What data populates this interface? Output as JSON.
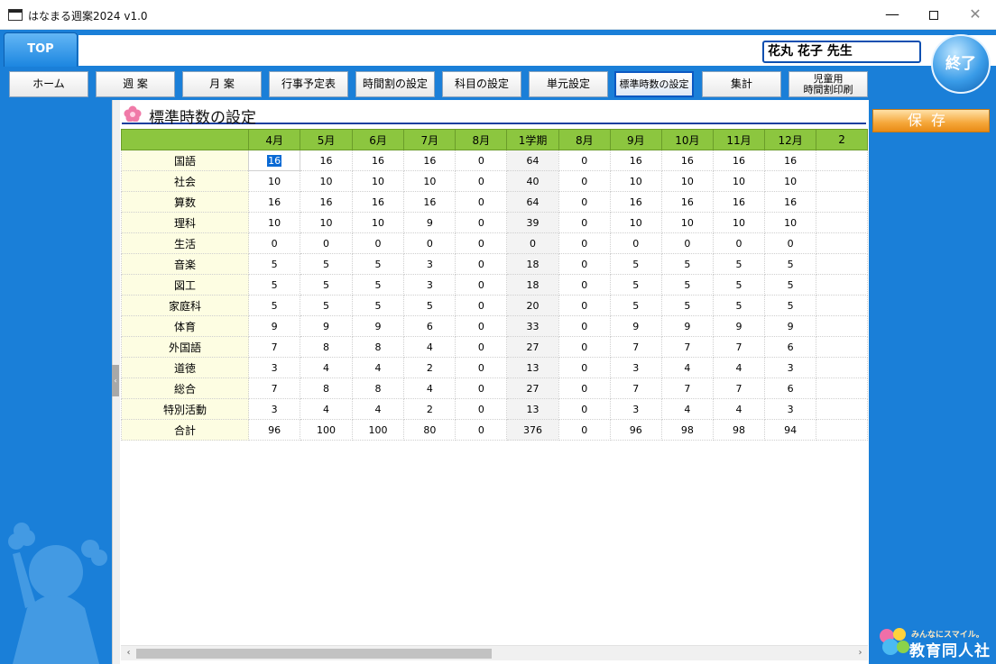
{
  "window": {
    "title": "はなまる週案2024 v1.0",
    "icon_text": "週案",
    "minimize": "—",
    "close": "✕"
  },
  "header": {
    "top_tab": "TOP",
    "user": "花丸 花子 先生",
    "exit": "終了"
  },
  "nav": [
    {
      "label": "ホーム"
    },
    {
      "label": "週 案"
    },
    {
      "label": "月 案"
    },
    {
      "label": "行事予定表"
    },
    {
      "label": "時間割の設定"
    },
    {
      "label": "科目の設定"
    },
    {
      "label": "単元設定"
    },
    {
      "label": "標準時数の設定",
      "active": true
    },
    {
      "label": "集計"
    },
    {
      "label": "児童用\n時間割印刷",
      "line1": "児童用",
      "line2": "時間割印刷"
    }
  ],
  "section": {
    "title": "標準時数の設定"
  },
  "actions": {
    "save": "保存"
  },
  "logo": {
    "tagline": "みんなにスマイル。",
    "name": "教育同人社"
  },
  "table": {
    "columns": [
      "4月",
      "5月",
      "6月",
      "7月",
      "8月",
      "1学期",
      "8月",
      "9月",
      "10月",
      "11月",
      "12月",
      "2"
    ],
    "rows": [
      {
        "subject": "国語",
        "values": [
          "16",
          "16",
          "16",
          "16",
          "0",
          "64",
          "0",
          "16",
          "16",
          "16",
          "16"
        ]
      },
      {
        "subject": "社会",
        "values": [
          "10",
          "10",
          "10",
          "10",
          "0",
          "40",
          "0",
          "10",
          "10",
          "10",
          "10"
        ]
      },
      {
        "subject": "算数",
        "values": [
          "16",
          "16",
          "16",
          "16",
          "0",
          "64",
          "0",
          "16",
          "16",
          "16",
          "16"
        ]
      },
      {
        "subject": "理科",
        "values": [
          "10",
          "10",
          "10",
          "9",
          "0",
          "39",
          "0",
          "10",
          "10",
          "10",
          "10"
        ]
      },
      {
        "subject": "生活",
        "values": [
          "0",
          "0",
          "0",
          "0",
          "0",
          "0",
          "0",
          "0",
          "0",
          "0",
          "0"
        ]
      },
      {
        "subject": "音楽",
        "values": [
          "5",
          "5",
          "5",
          "3",
          "0",
          "18",
          "0",
          "5",
          "5",
          "5",
          "5"
        ]
      },
      {
        "subject": "図工",
        "values": [
          "5",
          "5",
          "5",
          "3",
          "0",
          "18",
          "0",
          "5",
          "5",
          "5",
          "5"
        ]
      },
      {
        "subject": "家庭科",
        "values": [
          "5",
          "5",
          "5",
          "5",
          "0",
          "20",
          "0",
          "5",
          "5",
          "5",
          "5"
        ]
      },
      {
        "subject": "体育",
        "values": [
          "9",
          "9",
          "9",
          "6",
          "0",
          "33",
          "0",
          "9",
          "9",
          "9",
          "9"
        ]
      },
      {
        "subject": "外国語",
        "values": [
          "7",
          "8",
          "8",
          "4",
          "0",
          "27",
          "0",
          "7",
          "7",
          "7",
          "6"
        ]
      },
      {
        "subject": "道徳",
        "values": [
          "3",
          "4",
          "4",
          "2",
          "0",
          "13",
          "0",
          "3",
          "4",
          "4",
          "3"
        ]
      },
      {
        "subject": "総合",
        "values": [
          "7",
          "8",
          "8",
          "4",
          "0",
          "27",
          "0",
          "7",
          "7",
          "7",
          "6"
        ]
      },
      {
        "subject": "特別活動",
        "values": [
          "3",
          "4",
          "4",
          "2",
          "0",
          "13",
          "0",
          "3",
          "4",
          "4",
          "3"
        ]
      },
      {
        "subject": "合計",
        "values": [
          "96",
          "100",
          "100",
          "80",
          "0",
          "376",
          "0",
          "96",
          "98",
          "98",
          "94"
        ]
      }
    ]
  },
  "scrollbar": {
    "left": "‹",
    "right": "›"
  },
  "colors": {
    "blue": "#1a7fd8",
    "header_green": "#8cc63f",
    "subject_bg": "#fdfde2",
    "save_orange": "#f5a73a"
  }
}
